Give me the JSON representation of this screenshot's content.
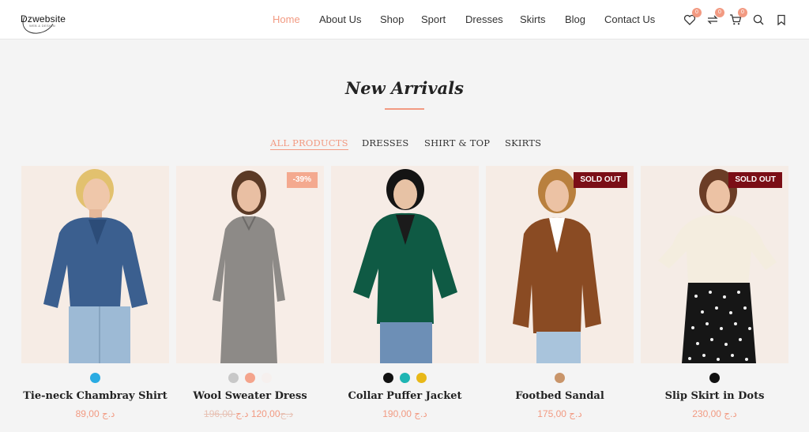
{
  "header": {
    "logo_text": "Dzwebsite",
    "logo_sub": "WEB & DESIGN",
    "nav": [
      {
        "label": "Home",
        "active": true
      },
      {
        "label": "About Us",
        "active": false
      },
      {
        "label": "Shop",
        "active": false
      },
      {
        "label": "Sport",
        "active": false
      },
      {
        "label": "Dresses",
        "active": false
      },
      {
        "label": "Skirts",
        "active": false
      },
      {
        "label": "Blog",
        "active": false
      },
      {
        "label": "Contact Us",
        "active": false
      }
    ],
    "wishlist_count": "0",
    "compare_count": "0",
    "cart_count": "0",
    "icons": [
      "heart-icon",
      "compare-icon",
      "cart-icon",
      "search-icon",
      "bookmark-icon"
    ]
  },
  "section": {
    "title": "New Arrivals"
  },
  "tabs": [
    {
      "label": "ALL PRODUCTS",
      "active": true
    },
    {
      "label": "DRESSES",
      "active": false
    },
    {
      "label": "SHIRT & TOP",
      "active": false
    },
    {
      "label": "SKIRTS",
      "active": false
    }
  ],
  "products": [
    {
      "name": "Tie-neck Chambray Shirt",
      "price": "89,00 د.ج",
      "old_price": "",
      "badge": "",
      "swatches": [
        "#29abe2"
      ]
    },
    {
      "name": "Wool Sweater Dress",
      "price": "120,00 د.ج",
      "old_price": "196,00 د.ج",
      "badge": "-39%",
      "swatches": [
        "#c8c8c8",
        "#f4a48c",
        "#f6f0ee"
      ]
    },
    {
      "name": "Collar Puffer Jacket",
      "price": "190,00 د.ج",
      "old_price": "",
      "badge": "",
      "swatches": [
        "#111111",
        "#1fb5b3",
        "#e8b818"
      ]
    },
    {
      "name": "Footbed Sandal",
      "price": "175,00 د.ج",
      "old_price": "",
      "badge": "SOLD OUT",
      "swatches": [
        "#c9956a"
      ]
    },
    {
      "name": "Slip Skirt in Dots",
      "price": "230,00 د.ج",
      "old_price": "",
      "badge": "SOLD OUT",
      "swatches": [
        "#111111"
      ]
    }
  ],
  "colors": {
    "accent": "#f29a82",
    "sold_out": "#7b0e16",
    "sale": "#f4a98f"
  }
}
